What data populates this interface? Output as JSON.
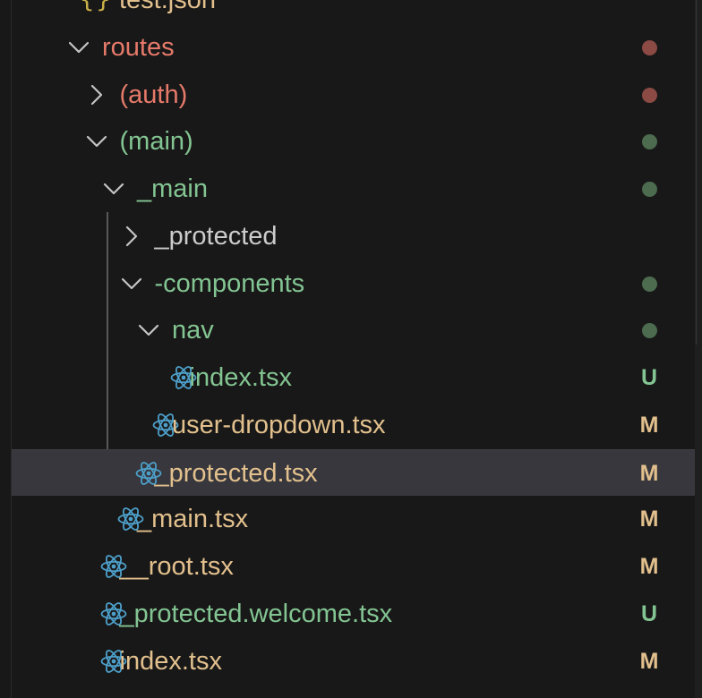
{
  "colors": {
    "background": "#181818",
    "selected_row": "#37373d",
    "red_folder": "#e67a6a",
    "green": "#83c592",
    "yellow": "#e2c08d",
    "white": "#cccccc",
    "react_icon": "#4d9fc9",
    "red_dot": "#8b4a44",
    "green_dot": "#4c6b4f",
    "json_icon": "#cbb148"
  },
  "tree": [
    {
      "label": "test.json",
      "kind": "file",
      "icon": "json-braces-icon",
      "level": 0,
      "color": "yellow",
      "status": null
    },
    {
      "label": "routes",
      "kind": "folder",
      "expanded": true,
      "level": 0,
      "color": "red_folder",
      "status": "dot",
      "status_color": "red_dot"
    },
    {
      "label": "(auth)",
      "kind": "folder",
      "expanded": false,
      "level": 1,
      "color": "red_folder",
      "status": "dot",
      "status_color": "red_dot"
    },
    {
      "label": "(main)",
      "kind": "folder",
      "expanded": true,
      "level": 1,
      "color": "green",
      "status": "dot",
      "status_color": "green_dot"
    },
    {
      "label": "_main",
      "kind": "folder",
      "expanded": true,
      "level": 2,
      "color": "green",
      "status": "dot",
      "status_color": "green_dot"
    },
    {
      "label": "_protected",
      "kind": "folder",
      "expanded": false,
      "level": 3,
      "color": "white",
      "status": null
    },
    {
      "label": "-components",
      "kind": "folder",
      "expanded": true,
      "level": 3,
      "color": "green",
      "status": "dot",
      "status_color": "green_dot"
    },
    {
      "label": "nav",
      "kind": "folder",
      "expanded": true,
      "level": 4,
      "color": "green",
      "status": "dot",
      "status_color": "green_dot"
    },
    {
      "label": "index.tsx",
      "kind": "file",
      "icon": "react-icon",
      "level": 5,
      "color": "green",
      "status": "U"
    },
    {
      "label": "user-dropdown.tsx",
      "kind": "file",
      "icon": "react-icon",
      "level": 4,
      "color": "yellow",
      "status": "M"
    },
    {
      "label": "_protected.tsx",
      "kind": "file",
      "icon": "react-icon",
      "level": 3,
      "color": "yellow",
      "status": "M",
      "selected": true
    },
    {
      "label": "_main.tsx",
      "kind": "file",
      "icon": "react-icon",
      "level": 2,
      "color": "yellow",
      "status": "M"
    },
    {
      "label": "__root.tsx",
      "kind": "file",
      "icon": "react-icon",
      "level": 1,
      "color": "yellow",
      "status": "M"
    },
    {
      "label": "_protected.welcome.tsx",
      "kind": "file",
      "icon": "react-icon",
      "level": 1,
      "color": "green",
      "status": "U"
    },
    {
      "label": "index.tsx",
      "kind": "file",
      "icon": "react-icon",
      "level": 1,
      "color": "yellow",
      "status": "M"
    }
  ]
}
